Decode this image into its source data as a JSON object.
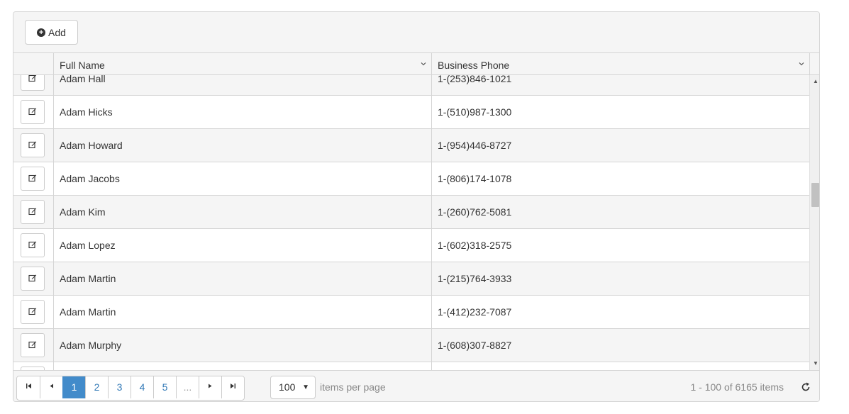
{
  "toolbar": {
    "add_label": "Add"
  },
  "columns": {
    "full_name": "Full Name",
    "business_phone": "Business Phone"
  },
  "rows": [
    {
      "name": "Adam Hall",
      "phone": "1-(253)846-1021"
    },
    {
      "name": "Adam Hicks",
      "phone": "1-(510)987-1300"
    },
    {
      "name": "Adam Howard",
      "phone": "1-(954)446-8727"
    },
    {
      "name": "Adam Jacobs",
      "phone": "1-(806)174-1078"
    },
    {
      "name": "Adam Kim",
      "phone": "1-(260)762-5081"
    },
    {
      "name": "Adam Lopez",
      "phone": "1-(602)318-2575"
    },
    {
      "name": "Adam Martin",
      "phone": "1-(215)764-3933"
    },
    {
      "name": "Adam Martin",
      "phone": "1-(412)232-7087"
    },
    {
      "name": "Adam Murphy",
      "phone": "1-(608)307-8827"
    },
    {
      "name": "",
      "phone": ""
    }
  ],
  "pager": {
    "pages": [
      "1",
      "2",
      "3",
      "4",
      "5",
      "..."
    ],
    "current_page": "1",
    "page_size": "100",
    "items_per_page_label": "items per page",
    "info": "1 - 100 of 6165 items"
  },
  "colors": {
    "accent": "#428bca",
    "border": "#d5d5d5",
    "alt_row": "#f5f5f5"
  }
}
